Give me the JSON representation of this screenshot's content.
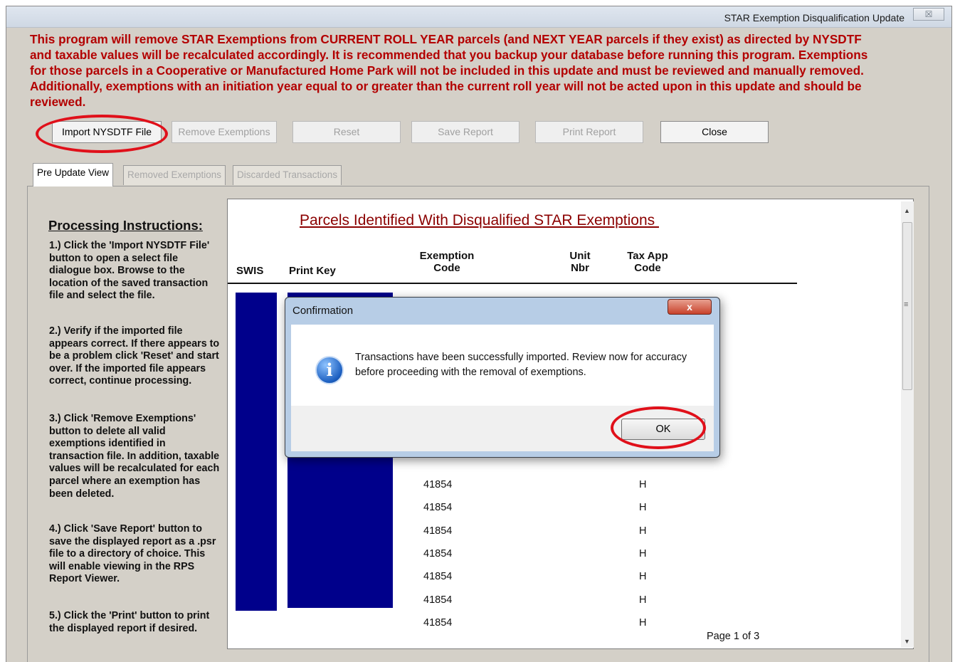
{
  "window": {
    "title": "STAR Exemption Disqualification Update",
    "close_glyph": "☒"
  },
  "intro_text": "This program will remove STAR Exemptions from CURRENT ROLL YEAR parcels (and NEXT YEAR parcels if they exist) as directed by NYSDTF and taxable values will be recalculated accordingly.  It is recommended that you backup your database before running this program.  Exemptions for those parcels in a Cooperative or Manufactured Home Park will not be included in this update and must be reviewed and manually removed.  Additionally, exemptions with an initiation year equal to or greater than the current roll year will not be acted upon in this update and should be reviewed.",
  "toolbar": {
    "import": "Import NYSDTF File",
    "remove": "Remove Exemptions",
    "reset": "Reset",
    "save": "Save Report",
    "print": "Print Report",
    "close": "Close"
  },
  "tabs": [
    "Pre Update View",
    "Removed Exemptions",
    "Discarded Transactions"
  ],
  "instructions": {
    "title": "Processing Instructions:",
    "steps": [
      "1.) Click the 'Import NYSDTF File' button to open a select file dialogue box.  Browse to the location of the saved transaction file and select the file.",
      "2.) Verify if the imported file appears correct.  If there appears to be a problem click 'Reset' and start over.  If the imported file appears correct, continue processing.",
      "3.) Click 'Remove Exemptions' button to delete all valid exemptions identified in transaction file.  In addition, taxable values will be recalculated for each parcel where an exemption has been deleted.",
      "4.) Click 'Save Report' button to save the displayed report as a .psr  file to a directory of choice.  This will enable viewing in the RPS Report Viewer.",
      "5.) Click the 'Print' button to print the displayed report if desired."
    ]
  },
  "report": {
    "title": "Parcels Identified With Disqualified STAR Exemptions ",
    "headers": {
      "swis": "SWIS",
      "print_key": "Print Key",
      "exemption_code": "Exemption\nCode",
      "unit_nbr": "Unit\nNbr",
      "tax_app_code": "Tax App\nCode"
    },
    "rows": [
      {
        "code": "41854",
        "tax": "H"
      },
      {
        "code": "41854",
        "tax": "H"
      },
      {
        "code": "41854",
        "tax": "H"
      },
      {
        "code": "41854",
        "tax": "H"
      },
      {
        "code": "41854",
        "tax": "H"
      },
      {
        "code": "41854",
        "tax": "H"
      },
      {
        "code": "41854",
        "tax": "H"
      }
    ],
    "page_label": "Page 1 of 3"
  },
  "dialog": {
    "title": "Confirmation",
    "close_glyph": "x",
    "message": "Transactions have been successfully imported.  Review now for accuracy before proceeding with the removal of exemptions.",
    "ok": "OK",
    "icon_glyph": "i"
  },
  "scrollbar": {
    "up": "▲",
    "down": "▼",
    "grip": "≡"
  },
  "colors": {
    "intro_red": "#b30000",
    "report_block_blue": "#00008b",
    "highlight_ring": "#e0101a"
  }
}
